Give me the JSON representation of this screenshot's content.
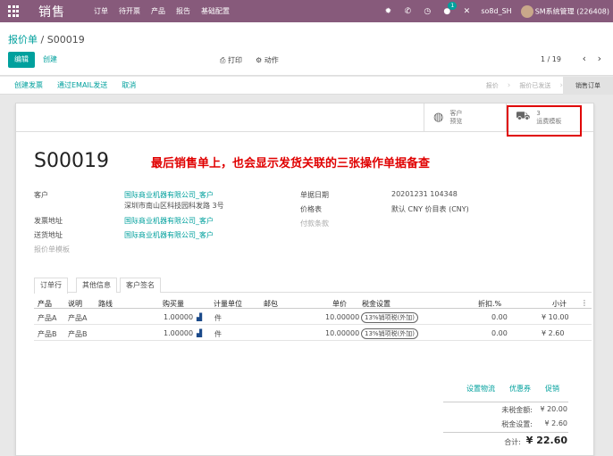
{
  "app": {
    "name": "销售",
    "menu": [
      "订单",
      "待开票",
      "产品",
      "报告",
      "基础配置"
    ],
    "chat_count": "1",
    "company": "so8d_SH",
    "user": "SM系统管理 (226408)"
  },
  "breadcrumb": {
    "parent": "报价单",
    "separator": "/",
    "current": "S00019"
  },
  "toolbar": {
    "edit_label": "编辑",
    "create_label": "创建",
    "print_label": "打印",
    "action_label": "动作",
    "pager": "1 / 19"
  },
  "statusbar": {
    "buttons": [
      "创建发票",
      "通过EMAIL发送",
      "取消"
    ],
    "stages": [
      "报价",
      "报价已发送",
      "销售订单"
    ]
  },
  "smart_buttons": {
    "preview": {
      "line1": "客户",
      "line2": "预览"
    },
    "delivery": {
      "count": "3",
      "label": "运费模板"
    }
  },
  "doc": {
    "number": "S00019",
    "annotation": "最后销售单上，也会显示发货关联的三张操作单据备查",
    "fields": {
      "customer_label": "客户",
      "customer_name": "国际商业机器有限公司_客户",
      "customer_address": "深圳市南山区科技园科发路 3号",
      "invoice_addr_label": "发票地址",
      "invoice_addr": "国际商业机器有限公司_客户",
      "delivery_addr_label": "送货地址",
      "delivery_addr": "国际商业机器有限公司_客户",
      "quote_template_label": "报价单模板",
      "date_label": "单据日期",
      "date_value": "20201231 104348",
      "pricelist_label": "价格表",
      "pricelist_value": "默认 CNY 价目表 (CNY)",
      "payment_terms_label": "付款条款"
    }
  },
  "tabs": [
    "订单行",
    "其他信息",
    "客户签名"
  ],
  "lines": {
    "headers": {
      "product": "产品",
      "description": "说明",
      "route": "路线",
      "qty": "购买量",
      "uom": "计量单位",
      "package": "邮包",
      "price": "单价",
      "taxes": "税金设置",
      "discount": "折扣.%",
      "subtotal": "小计"
    },
    "rows": [
      {
        "product": "产品A",
        "description": "产品A",
        "qty": "1.00000",
        "uom": "件",
        "price": "10.00000",
        "tax": "13%销项税(外加)",
        "discount": "0.00",
        "subtotal": "¥ 10.00"
      },
      {
        "product": "产品B",
        "description": "产品B",
        "qty": "1.00000",
        "uom": "件",
        "price": "10.00000",
        "tax": "13%销项税(外加)",
        "discount": "0.00",
        "subtotal": "¥ 2.60"
      }
    ]
  },
  "bottom_links": [
    "设置物流",
    "优惠券",
    "促销"
  ],
  "totals": {
    "untaxed_label": "未税金额:",
    "untaxed_value": "¥ 20.00",
    "tax_label": "税金设置:",
    "tax_value": "¥ 2.60",
    "total_label": "合计:",
    "total_value": "¥ 22.60"
  }
}
